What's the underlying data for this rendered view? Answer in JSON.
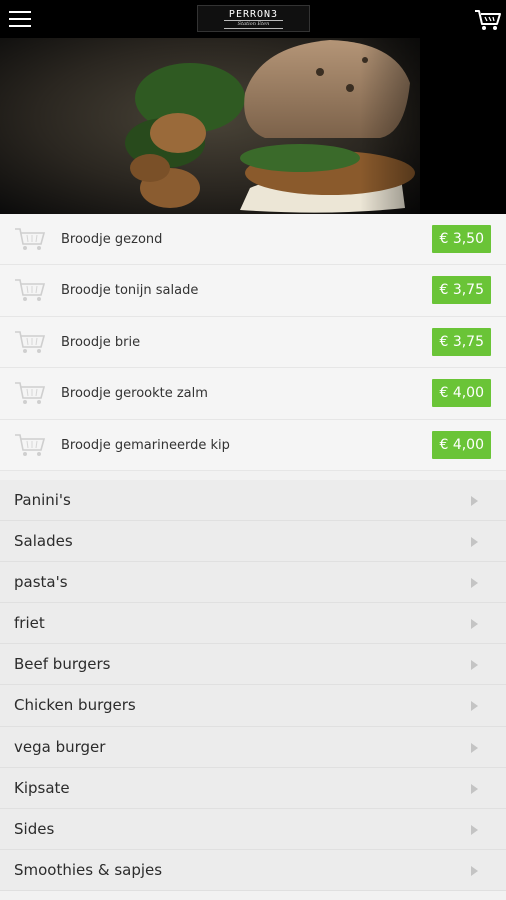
{
  "header": {
    "logo_text": "PERRON3",
    "logo_subtext": "Station Eten",
    "menu_icon": "hamburger-menu-icon",
    "cart_icon": "shopping-cart-icon"
  },
  "hero": {
    "image": "sandwich-with-walnuts-photo"
  },
  "products": [
    {
      "name": "Broodje gezond",
      "price": "€ 3,50"
    },
    {
      "name": "Broodje tonijn salade",
      "price": "€ 3,75"
    },
    {
      "name": "Broodje brie",
      "price": "€ 3,75"
    },
    {
      "name": "Broodje gerookte zalm",
      "price": "€ 4,00"
    },
    {
      "name": "Broodje gemarineerde kip",
      "price": "€ 4,00"
    }
  ],
  "categories": [
    {
      "name": "Panini's"
    },
    {
      "name": "Salades"
    },
    {
      "name": "pasta's"
    },
    {
      "name": "friet"
    },
    {
      "name": "Beef burgers"
    },
    {
      "name": "Chicken burgers"
    },
    {
      "name": "vega burger"
    },
    {
      "name": "Kipsate"
    },
    {
      "name": "Sides"
    },
    {
      "name": "Smoothies & sapjes"
    }
  ],
  "colors": {
    "price_badge": "#6ac437",
    "topbar": "#000000",
    "category_bg": "#ececec"
  }
}
